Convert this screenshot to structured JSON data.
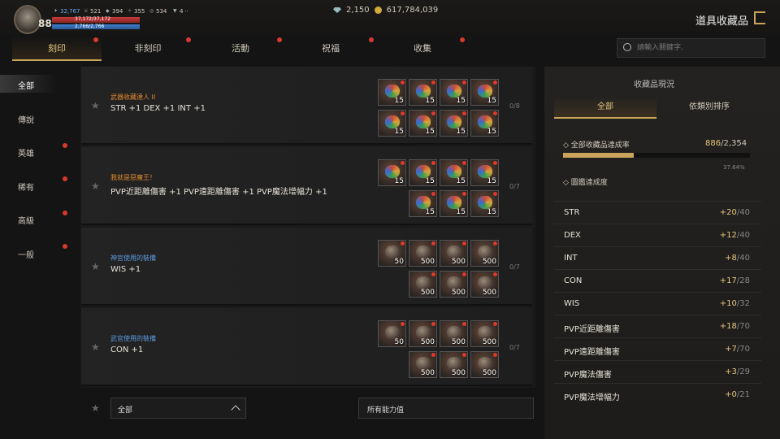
{
  "topbar": {
    "level": "88",
    "stats": [
      "32,767",
      "521",
      "394",
      "355",
      "534",
      "4"
    ],
    "hp_text": "37,172/37,172",
    "hp_fraction": 1.0,
    "mp_text": "2,766/2,766",
    "mp_fraction": 1.0,
    "diamonds": "2,150",
    "gold": "617,784,039",
    "page_title": "道具收藏品"
  },
  "tabs": [
    {
      "label": "刻印",
      "active": true
    },
    {
      "label": "非刻印"
    },
    {
      "label": "活動"
    },
    {
      "label": "祝福"
    },
    {
      "label": "收集"
    }
  ],
  "search": {
    "placeholder": "請輸入關鍵字."
  },
  "sidebar": {
    "items": [
      {
        "label": "全部",
        "active": true
      },
      {
        "label": "傳說"
      },
      {
        "label": "英雄"
      },
      {
        "label": "稀有"
      },
      {
        "label": "高級"
      },
      {
        "label": "一般"
      }
    ]
  },
  "collections": [
    {
      "title": "武器收藏達人 II",
      "title_color": "#e0892e",
      "effect": "STR +1 DEX +1 INT +1",
      "count": "0/8",
      "orb": "color",
      "items": [
        "15",
        "15",
        "15",
        "15",
        "15",
        "15",
        "15",
        "15"
      ]
    },
    {
      "title": "我就是惡魔王！",
      "title_color": "#e0892e",
      "effect": "PVP近距離傷害 +1 PVP遠距離傷害 +1 PVP魔法增幅力 +1",
      "count": "0/7",
      "orb": "color",
      "items": [
        "15",
        "15",
        "15",
        "15",
        "15",
        "15",
        "15"
      ]
    },
    {
      "title": "神官使用的裝備",
      "title_color": "#5b9be0",
      "effect": "WIS +1",
      "count": "0/7",
      "orb": "gray",
      "items": [
        "50",
        "500",
        "500",
        "500",
        "500",
        "500",
        "500"
      ]
    },
    {
      "title": "武官使用的裝備",
      "title_color": "#5b9be0",
      "effect": "CON +1",
      "count": "0/7",
      "orb": "gray",
      "items": [
        "50",
        "500",
        "500",
        "500",
        "500",
        "500",
        "500"
      ]
    }
  ],
  "footer": {
    "filter1": "全部",
    "filter2": "所有能力值"
  },
  "panel": {
    "title": "收藏品現況",
    "tab_all": "全部",
    "tab_sort": "依類別排序",
    "completion_label": "◇ 全部收藏品達成率",
    "completion_have": "886",
    "completion_total": "/2,354",
    "completion_percent": "37.64%",
    "completion_fraction": 0.3764,
    "codex_label": "◇ 圖鑑達成度",
    "stats": [
      {
        "name": "STR",
        "have": "+20",
        "total": "/40"
      },
      {
        "name": "DEX",
        "have": "+12",
        "total": "/40"
      },
      {
        "name": "INT",
        "have": "+8",
        "total": "/40"
      },
      {
        "name": "CON",
        "have": "+17",
        "total": "/28"
      },
      {
        "name": "WIS",
        "have": "+10",
        "total": "/32"
      },
      {
        "name": "PVP近距離傷害",
        "have": "+18",
        "total": "/70"
      },
      {
        "name": "PVP遠距離傷害",
        "have": "+7",
        "total": "/70"
      },
      {
        "name": "PVP魔法傷害",
        "have": "+3",
        "total": "/29"
      },
      {
        "name": "PVP魔法增幅力",
        "have": "+0",
        "total": "/21"
      }
    ]
  }
}
